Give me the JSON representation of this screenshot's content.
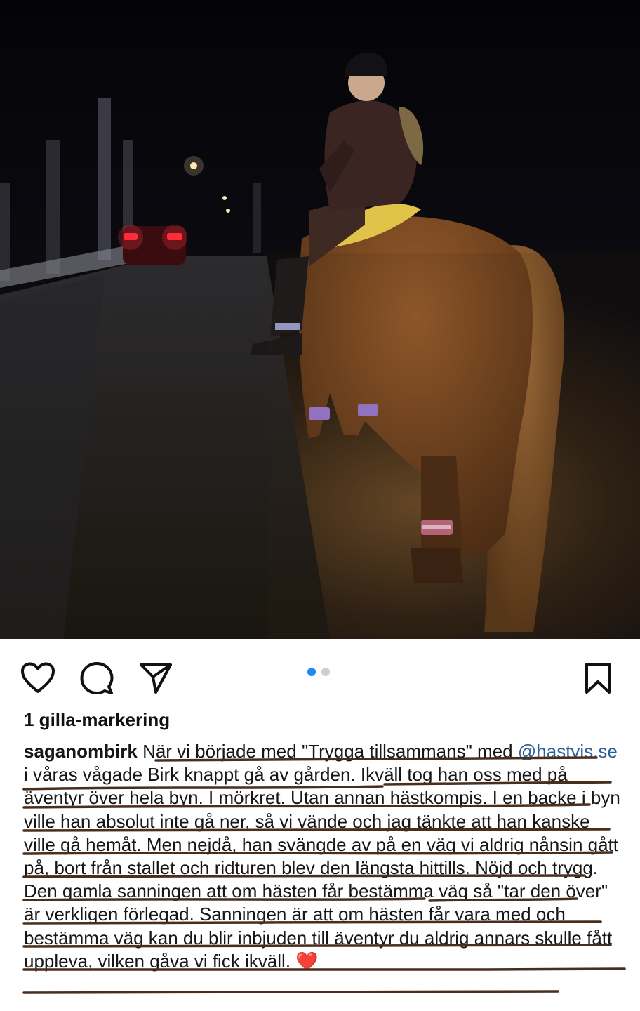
{
  "post": {
    "likes_text": "1 gilla-markering",
    "username": "saganombirk",
    "caption_before_mention": "När vi började med \"Trygga tillsammans\" med",
    "mention": "@hastvis.se",
    "caption_after_mention": "i våras vågade Birk knappt gå av gården. Ikväll tog han oss med på äventyr över hela byn. I mörkret. Utan annan hästkompis. I en backe i byn ville han absolut inte gå ner, så vi vände och jag tänkte att han kanske ville gå hemåt. Men nejdå, han svängde av på en väg vi aldrig nånsin gått på, bort från stallet och ridturen blev den längsta hittills. Nöjd och trygg. Den gamla sanningen att om hästen får bestämma väg så \"tar den över\" är verkligen förlegad. Sanningen är att om hästen får vara med och bestämma väg kan du blir inbjuden till äventyr du aldrig annars skulle fått uppleva, vilken gåva vi fick ikväll.",
    "emoji": "❤️"
  },
  "carousel": {
    "total": 2,
    "active_index": 0,
    "active_color": "#1d8bf1",
    "inactive_color": "#cfcfd3"
  },
  "icons": [
    "heart-icon",
    "comment-icon",
    "share-icon",
    "bookmark-icon"
  ],
  "colors": {
    "underline": "#4a2e1c",
    "mention": "#2f5f95"
  }
}
